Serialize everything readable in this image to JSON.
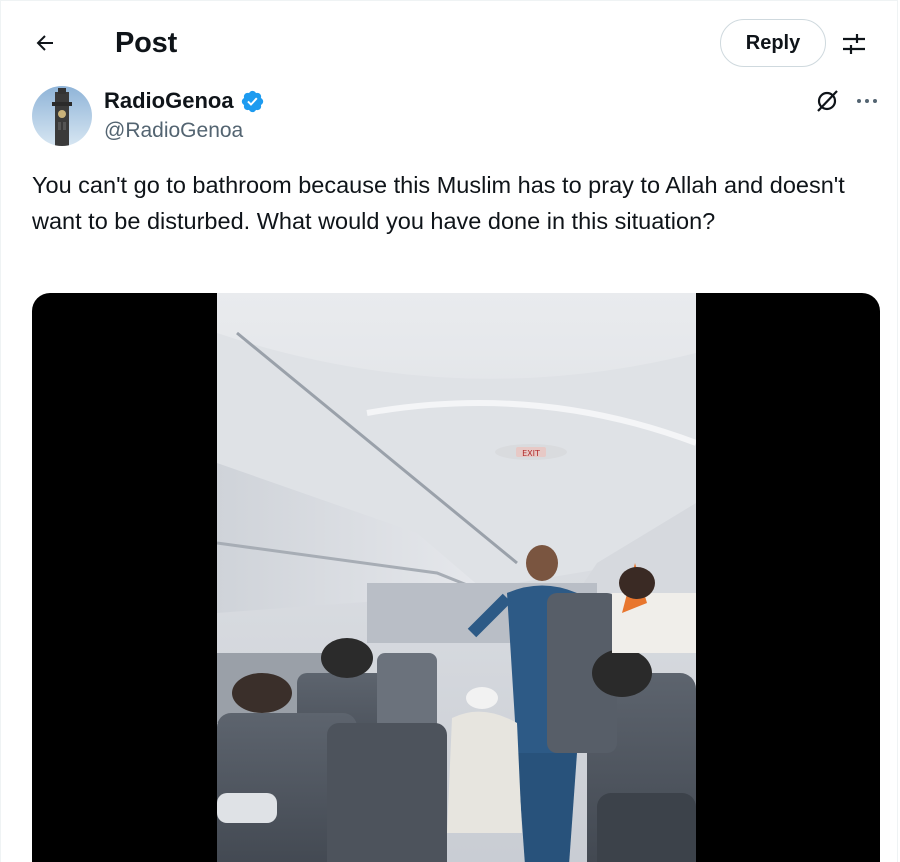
{
  "header": {
    "title": "Post",
    "back_icon": "arrow-left-icon",
    "reply_label": "Reply",
    "filter_icon": "sliders-icon"
  },
  "author": {
    "name": "RadioGenoa",
    "handle": "@RadioGenoa",
    "verified": true,
    "avatar_icon": "tower-avatar",
    "grok_icon": "grok-icon",
    "more_icon": "more-dots-icon"
  },
  "post": {
    "text": "You can't go to bathroom because this Muslim has to pray to Allah and doesn't want to be disturbed. What would you have done in this situation?"
  },
  "media": {
    "type": "video",
    "exit_sign": "EXIT"
  },
  "colors": {
    "verified_blue": "#1d9bf0",
    "text_primary": "#0f1419",
    "text_secondary": "#536471",
    "border": "#cfd9de"
  }
}
